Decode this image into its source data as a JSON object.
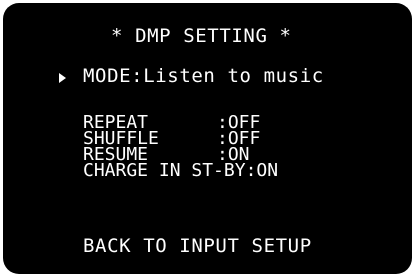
{
  "screen": {
    "title": "* DMP SETTING *",
    "mode_label": "MODE:",
    "mode_value": "Listen to music",
    "settings": [
      {
        "label": "REPEAT",
        "value": ":OFF"
      },
      {
        "label": "SHUFFLE",
        "value": ":OFF"
      },
      {
        "label": "RESUME",
        "value": ":ON"
      },
      {
        "label": "CHARGE IN ST-BY",
        "value": ":ON"
      }
    ],
    "back_label": "BACK TO INPUT SETUP"
  }
}
